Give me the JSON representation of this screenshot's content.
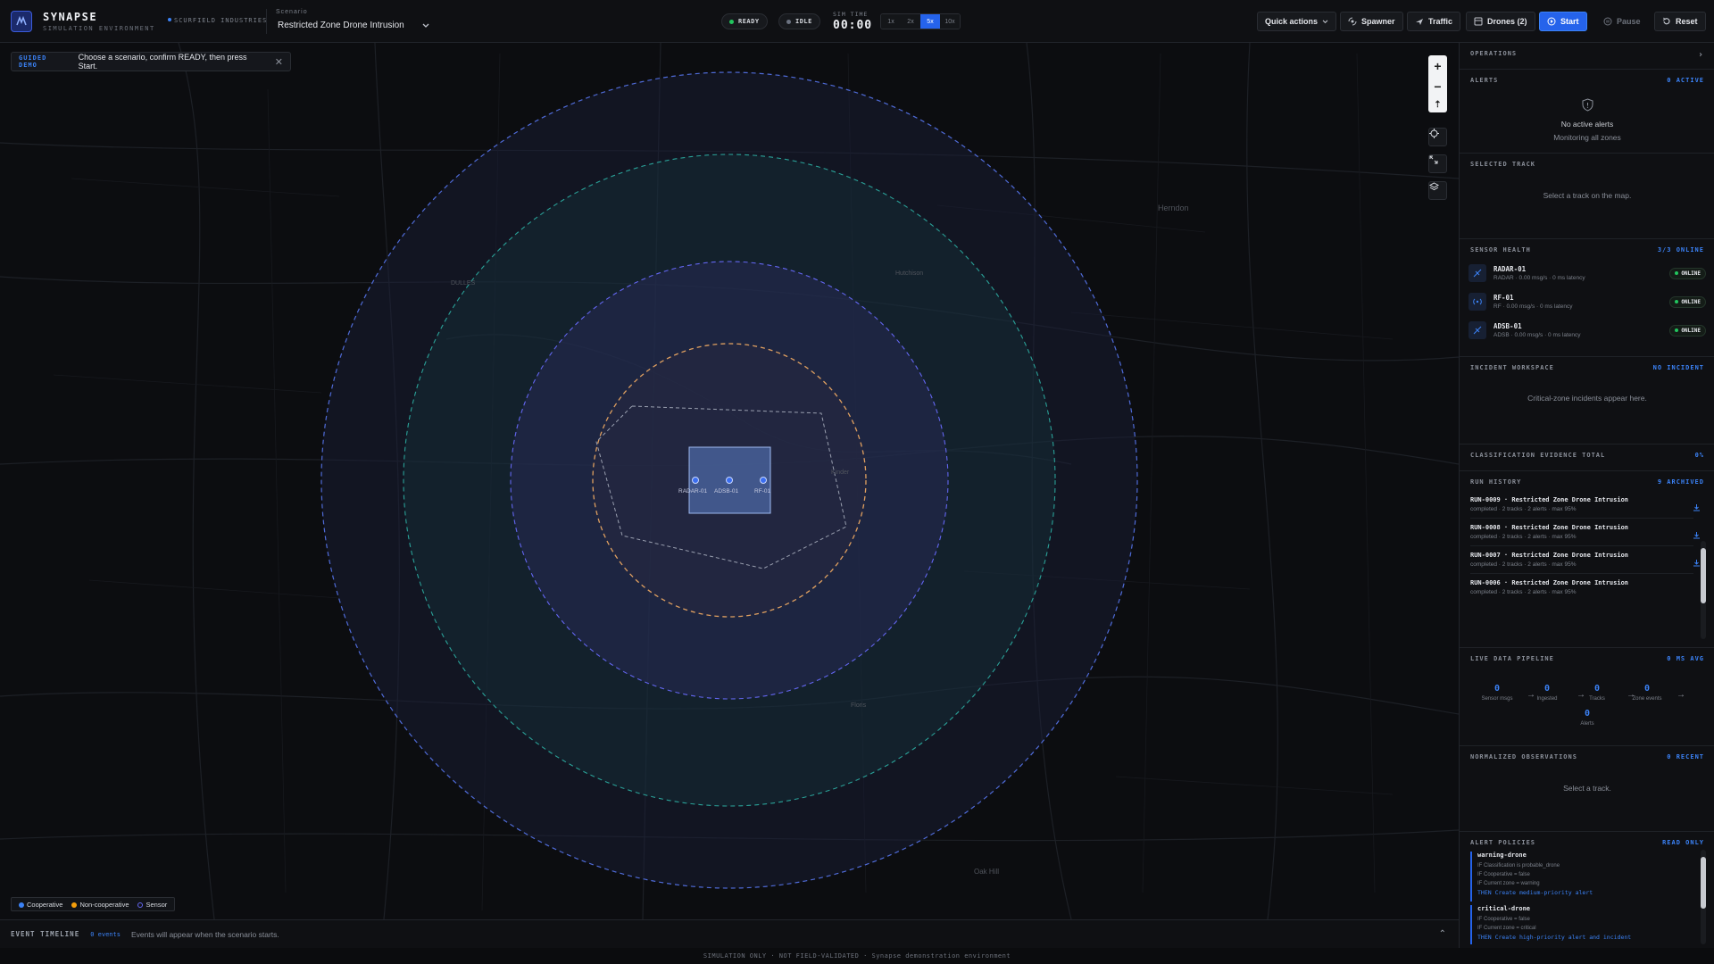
{
  "app": {
    "name": "SYNAPSE",
    "subtitle": "SIMULATION ENVIRONMENT",
    "org": "SCURFIELD INDUSTRIES"
  },
  "scenario": {
    "label": "Scenario",
    "selected": "Restricted Zone Drone Intrusion"
  },
  "status": {
    "ready": "READY",
    "idle": "IDLE",
    "sim_time_label": "SIM TIME",
    "sim_time": "00:00"
  },
  "speeds": [
    "1x",
    "2x",
    "5x",
    "10x"
  ],
  "speed_selected": "5x",
  "toolbar": {
    "quick_actions": "Quick actions",
    "spawner": "Spawner",
    "traffic": "Traffic",
    "drones": "Drones (2)",
    "start": "Start",
    "pause": "Pause",
    "reset": "Reset"
  },
  "guided": {
    "tag": "GUIDED DEMO",
    "message": "Choose a scenario, confirm READY, then press Start."
  },
  "map": {
    "place_labels": [
      "Herndon",
      "DULLES",
      "Hutchison",
      "Oak Hill",
      "Floris",
      "Kinder"
    ],
    "sensor_labels": [
      "RADAR-01",
      "ADSB-01",
      "RF-01"
    ],
    "zoom_in": "+",
    "zoom_out": "−",
    "compass": "⇡"
  },
  "legend": {
    "cooperative": "Cooperative",
    "noncooperative": "Non-cooperative",
    "sensor": "Sensor"
  },
  "timeline": {
    "label": "EVENT TIMELINE",
    "count": "0 events",
    "message": "Events will appear when the scenario starts."
  },
  "footer": "SIMULATION ONLY · NOT FIELD-VALIDATED · Synapse demonstration environment",
  "panel": {
    "operations": "OPERATIONS",
    "alerts": {
      "title": "ALERTS",
      "badge": "0 ACTIVE",
      "empty": "No active alerts",
      "sub": "Monitoring all zones"
    },
    "selected_track": {
      "title": "SELECTED TRACK",
      "empty": "Select a track on the map."
    },
    "sensor_health": {
      "title": "SENSOR HEALTH",
      "badge": "3/3 ONLINE",
      "sensors": [
        {
          "name": "RADAR-01",
          "meta": "RADAR · 0.00 msg/s · 0 ms latency",
          "status": "ONLINE",
          "icon": "radar-icon"
        },
        {
          "name": "RF-01",
          "meta": "RF · 0.00 msg/s · 0 ms latency",
          "status": "ONLINE",
          "icon": "rf-icon"
        },
        {
          "name": "ADSB-01",
          "meta": "ADSB · 0.00 msg/s · 0 ms latency",
          "status": "ONLINE",
          "icon": "adsb-icon"
        }
      ]
    },
    "incident": {
      "title": "INCIDENT WORKSPACE",
      "badge": "NO INCIDENT",
      "empty": "Critical-zone incidents appear here."
    },
    "classification": {
      "title": "CLASSIFICATION EVIDENCE TOTAL",
      "badge": "0%"
    },
    "run_history": {
      "title": "RUN HISTORY",
      "badge": "9 ARCHIVED",
      "runs": [
        {
          "title": "RUN-0009 · Restricted Zone Drone Intrusion",
          "meta": "completed · 2 tracks · 2 alerts · max 95%"
        },
        {
          "title": "RUN-0008 · Restricted Zone Drone Intrusion",
          "meta": "completed · 2 tracks · 2 alerts · max 95%"
        },
        {
          "title": "RUN-0007 · Restricted Zone Drone Intrusion",
          "meta": "completed · 2 tracks · 2 alerts · max 95%"
        },
        {
          "title": "RUN-0006 · Restricted Zone Drone Intrusion",
          "meta": "completed · 2 tracks · 2 alerts · max 95%"
        }
      ]
    },
    "pipeline": {
      "title": "LIVE DATA PIPELINE",
      "badge": "0 MS AVG",
      "stages": [
        {
          "value": "0",
          "label": "Sensor msgs"
        },
        {
          "value": "0",
          "label": "Ingested"
        },
        {
          "value": "0",
          "label": "Tracks"
        },
        {
          "value": "0",
          "label": "Zone events"
        },
        {
          "value": "0",
          "label": "Alerts"
        }
      ]
    },
    "observations": {
      "title": "NORMALIZED OBSERVATIONS",
      "badge": "0 RECENT",
      "empty": "Select a track."
    },
    "policies": {
      "title": "ALERT POLICIES",
      "badge": "READ ONLY",
      "items": [
        {
          "name": "warning-drone",
          "lines": [
            "IF Classification is probable_drone",
            "IF Cooperative = false",
            "IF Current zone = warning"
          ],
          "then": "THEN Create medium-priority alert"
        },
        {
          "name": "critical-drone",
          "lines": [
            "IF Cooperative = false",
            "IF Current zone = critical"
          ],
          "then": "THEN Create high-priority alert and incident"
        }
      ]
    }
  },
  "colors": {
    "accent": "#2563eb",
    "cooperative": "#3b82f6",
    "noncooperative": "#f59e0b",
    "sensor": "#6366f1",
    "online": "#22c55e"
  }
}
